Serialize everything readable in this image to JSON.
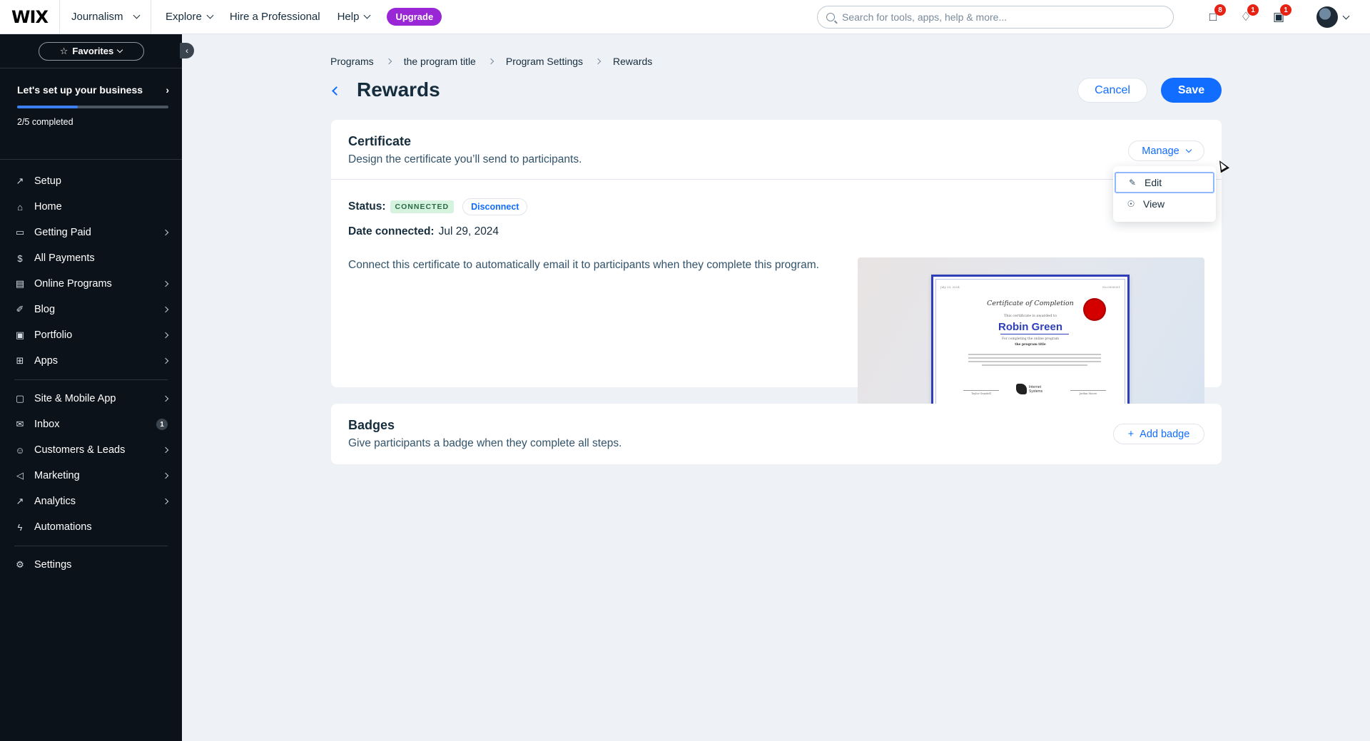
{
  "topbar": {
    "logo": "WIX",
    "site_name": "Journalism",
    "nav": [
      {
        "label": "Explore"
      },
      {
        "label": "Hire a Professional"
      },
      {
        "label": "Help"
      }
    ],
    "upgrade_label": "Upgrade",
    "search_placeholder": "Search for tools, apps, help & more...",
    "notifications": {
      "chat": "8",
      "bell": "1",
      "inbox": "1"
    }
  },
  "sidebar": {
    "favorites_label": "Favorites",
    "setup": {
      "title": "Let's set up your business",
      "progress": "2/5 completed",
      "progress_fraction": 0.4
    },
    "items": [
      {
        "label": "Setup",
        "icon": "rocket-icon"
      },
      {
        "label": "Home",
        "icon": "home-icon"
      },
      {
        "label": "Getting Paid",
        "icon": "wallet-icon"
      },
      {
        "label": "All Payments",
        "icon": "dollar-icon"
      },
      {
        "label": "Online Programs",
        "icon": "programs-icon"
      },
      {
        "label": "Blog",
        "icon": "pen-icon"
      },
      {
        "label": "Portfolio",
        "icon": "portfolio-icon"
      },
      {
        "label": "Apps",
        "icon": "apps-icon"
      },
      {
        "label": "Site & Mobile App",
        "icon": "site-icon"
      },
      {
        "label": "Inbox",
        "icon": "inbox-icon",
        "count": "1"
      },
      {
        "label": "Customers & Leads",
        "icon": "customers-icon"
      },
      {
        "label": "Marketing",
        "icon": "megaphone-icon"
      },
      {
        "label": "Analytics",
        "icon": "analytics-icon"
      },
      {
        "label": "Automations",
        "icon": "bolt-icon"
      },
      {
        "label": "Settings",
        "icon": "gear-icon"
      }
    ]
  },
  "breadcrumb": [
    "Programs",
    "the program title",
    "Program Settings",
    "Rewards"
  ],
  "page": {
    "title": "Rewards",
    "cancel_label": "Cancel",
    "save_label": "Save"
  },
  "certificate": {
    "title": "Certificate",
    "subtitle": "Design the certificate you’ll send to participants.",
    "manage_label": "Manage",
    "status_label": "Status:",
    "status_value": "CONNECTED",
    "disconnect_label": "Disconnect",
    "date_label": "Date connected:",
    "date_value": "Jul 29, 2024",
    "description": "Connect this certificate to automatically email it to participants when they complete this program.",
    "preview": {
      "date": "July 29, 2024",
      "corner": "No.0000001",
      "heading": "Certificate of Completion",
      "awarded": "This certificate is awarded to",
      "name": "Robin Green",
      "for": "For completing the online program",
      "program": "the program title",
      "org": "Internet Systems",
      "sig_left": "Taylor Grandell",
      "sig_right": "Jordan Moore"
    }
  },
  "manage_menu": [
    {
      "label": "Edit",
      "icon": "pencil-icon"
    },
    {
      "label": "View",
      "icon": "eye-icon"
    }
  ],
  "badges": {
    "title": "Badges",
    "subtitle": "Give participants a badge when they complete all steps.",
    "add_label": "Add badge"
  }
}
